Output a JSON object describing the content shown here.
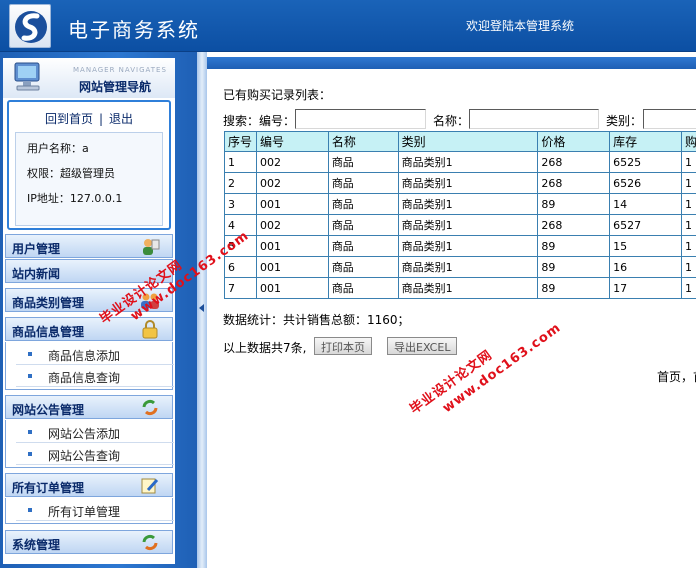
{
  "header": {
    "title": "电子商务系统",
    "welcome": "欢迎登陆本管理系统"
  },
  "sidebar": {
    "nav_subtitle": "MANAGER NAVIGATES",
    "nav_title": "网站管理导航",
    "home_link": "回到首页",
    "separator": "|",
    "logout_link": "退出",
    "user_label": "用户名称：a",
    "role_label": "权限：超级管理员",
    "ip_label": "IP地址：127.0.0.1",
    "menus": [
      {
        "label": "用户管理",
        "icon": "users-icon"
      },
      {
        "label": "站内新闻",
        "icon": ""
      },
      {
        "label": "商品类别管理",
        "icon": "group-icon"
      },
      {
        "label": "商品信息管理",
        "icon": "lock-icon"
      },
      {
        "label": "网站公告管理",
        "icon": "refresh-icon"
      },
      {
        "label": "所有订单管理",
        "icon": "edit-icon"
      },
      {
        "label": "系统管理",
        "icon": "refresh-icon"
      }
    ],
    "sub_product": [
      "商品信息添加",
      "商品信息查询"
    ],
    "sub_notice": [
      "网站公告添加",
      "网站公告查询"
    ],
    "sub_order": [
      "所有订单管理"
    ]
  },
  "main": {
    "list_title": "已有购买记录列表：",
    "search": {
      "label": "搜索：",
      "code_label": "编号：",
      "name_label": "名称：",
      "category_label": "类别："
    },
    "table": {
      "headers": [
        "序号",
        "编号",
        "名称",
        "类别",
        "价格",
        "库存",
        "购"
      ],
      "rows": [
        [
          "1",
          "002",
          "商品",
          "商品类别1",
          "268",
          "6525",
          "1"
        ],
        [
          "2",
          "002",
          "商品",
          "商品类别1",
          "268",
          "6526",
          "1"
        ],
        [
          "3",
          "001",
          "商品",
          "商品类别1",
          "89",
          "14",
          "1"
        ],
        [
          "4",
          "002",
          "商品",
          "商品类别1",
          "268",
          "6527",
          "1"
        ],
        [
          "5",
          "001",
          "商品",
          "商品类别1",
          "89",
          "15",
          "1"
        ],
        [
          "6",
          "001",
          "商品",
          "商品类别1",
          "89",
          "16",
          "1"
        ],
        [
          "7",
          "001",
          "商品",
          "商品类别1",
          "89",
          "17",
          "1"
        ]
      ]
    },
    "stats": "数据统计：共计销售总额：1160；",
    "summary": "以上数据共7条,",
    "print_button": "打印本页",
    "export_button": "导出EXCEL",
    "pager": "首页，首"
  },
  "watermarks": [
    "毕业设计论文网",
    "www.doc163.com"
  ],
  "colors": {
    "header_blue": "#0c4fa3",
    "table_header": "#c6f1f5",
    "watermark_red": "#e0101a"
  }
}
